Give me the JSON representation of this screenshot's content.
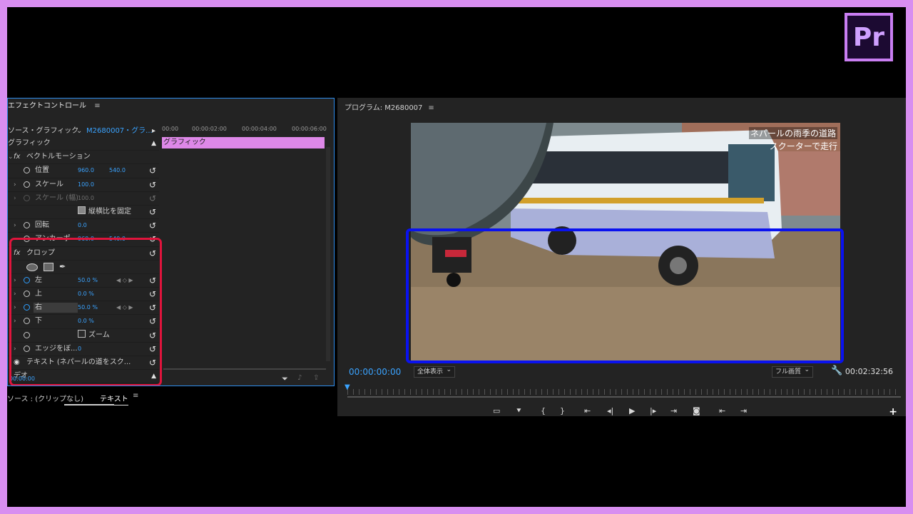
{
  "logo": {
    "text": "Pr"
  },
  "effect_controls": {
    "tab_title": "エフェクトコントロール",
    "source_label": "ソース・グラフィック",
    "clip_label": "M2680007・グラ...",
    "timecodes": [
      "00:00",
      "00:00:02:00",
      "00:00:04:00",
      "00:00:06:00"
    ],
    "clip_bar_label": "グラフィック",
    "section_graphic": "グラフィック",
    "vector_motion": "ベクトルモーション",
    "position_label": "位置",
    "position_x": "960.0",
    "position_y": "540.0",
    "scale_label": "スケール",
    "scale_value": "100.0",
    "scale_width_label": "スケール (幅)",
    "scale_width_value": "100.0",
    "uniform_scale_label": "縦横比を固定",
    "rotation_label": "回転",
    "rotation_value": "0.0",
    "anchor_label": "アンカーポ",
    "anchor_x": "960.0",
    "anchor_y": "540.0",
    "crop_label": "クロップ",
    "left_label": "左",
    "left_value": "50.0 %",
    "top_label": "上",
    "top_value": "0.0 %",
    "right_label": "右",
    "right_value": "50.0 %",
    "bottom_label": "下",
    "bottom_value": "0.0 %",
    "zoom_label": "ズーム",
    "edge_label": "エッジをぼ...",
    "edge_value": "0",
    "text_layer_label": "テキスト (ネパールの道をスク...",
    "video_label": "デオ",
    "timecode": "00:00:00"
  },
  "bottom_tabs": {
    "source": "ソース : (クリップなし)",
    "text": "テキスト"
  },
  "program_monitor": {
    "title": "プログラム: M2680007",
    "caption_line1": "ネパールの雨季の道路",
    "caption_line2": "スクーターで走行",
    "timecode_current": "00:00:00:00",
    "zoom_select": "全体表示",
    "quality_select": "フル画質",
    "timecode_duration": "00:02:32:56"
  },
  "colors": {
    "accent": "#2d8ceb",
    "timecode_blue": "#3aa3ff",
    "clip_pink": "#de88e8",
    "highlight_red": "#e0143c",
    "highlight_blue": "#0a12ef",
    "border_purple": "#d88ef0"
  }
}
